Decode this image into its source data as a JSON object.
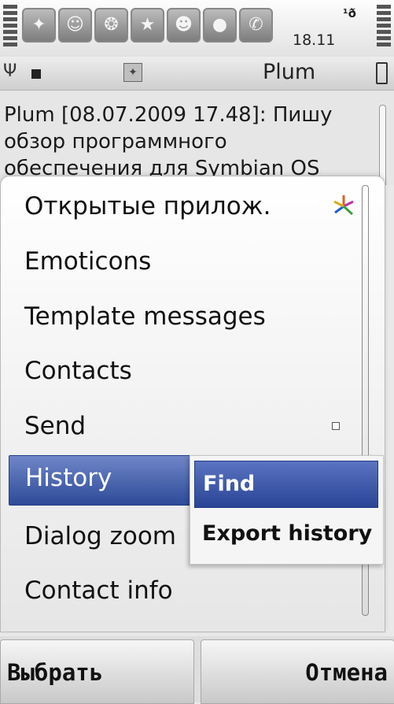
{
  "status_bar": {
    "time": "18.11",
    "tray_icon": "bluetooth-lock-icon",
    "tray_text": "¹ð",
    "apps": [
      {
        "name": "contacts-group-icon",
        "glyph": "✦"
      },
      {
        "name": "person-icon",
        "glyph": "☺"
      },
      {
        "name": "lightbulb-icon",
        "glyph": "❂"
      },
      {
        "name": "running-man-icon",
        "glyph": "★"
      },
      {
        "name": "smiley-icon",
        "glyph": "☻"
      },
      {
        "name": "chat-bubble-icon",
        "glyph": "●"
      },
      {
        "name": "phone-person-icon",
        "glyph": "✆"
      }
    ]
  },
  "title_bar": {
    "title": "Plum",
    "antenna_glyph": "Ψ"
  },
  "chat": {
    "message": "Plum [08.07.2009 17.48]: Пишу обзор программного обеспечения для Symbian OS"
  },
  "menu": {
    "items": [
      {
        "label": "Открытые прилож.",
        "icon": "open-apps-spark-icon"
      },
      {
        "label": "Emoticons"
      },
      {
        "label": "Template messages"
      },
      {
        "label": "Contacts"
      },
      {
        "label": "Send",
        "icon": "submenu-indicator-icon"
      },
      {
        "label": "History",
        "selected": true
      },
      {
        "label": "Dialog zoom"
      },
      {
        "label": "Contact info"
      }
    ]
  },
  "submenu": {
    "items": [
      {
        "label": "Find",
        "selected": true
      },
      {
        "label": "Export history"
      }
    ]
  },
  "softkeys": {
    "left": "Выбрать",
    "right": "Отмена"
  },
  "colors": {
    "highlight_top": "#6f86c7",
    "highlight_bottom": "#2e4b99",
    "highlight_text": "#ffffff"
  }
}
